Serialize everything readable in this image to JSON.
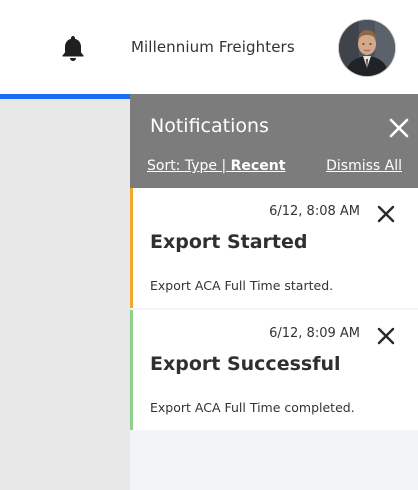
{
  "header": {
    "company_name": "Millennium Freighters",
    "bell_icon": "bell-icon",
    "avatar_icon": "user-avatar"
  },
  "progress": {
    "value_percent": 100,
    "color": "#1a6ef2"
  },
  "notifications": {
    "title": "Notifications",
    "close_icon": "close-icon",
    "sort": {
      "prefix": "Sort: ",
      "type_label": "Type",
      "separator": " | ",
      "recent_label": "Recent",
      "active": "Recent"
    },
    "dismiss_all_label": "Dismiss All",
    "header_color": "#7c7c7c",
    "items": [
      {
        "time": "6/12, 8:08 AM",
        "title": "Export Started",
        "message": "Export ACA Full Time started.",
        "accent_color": "#f0a830"
      },
      {
        "time": "6/12, 8:09 AM",
        "title": "Export Successful",
        "message": "Export ACA Full Time completed.",
        "accent_color": "#8fd08f"
      }
    ]
  }
}
